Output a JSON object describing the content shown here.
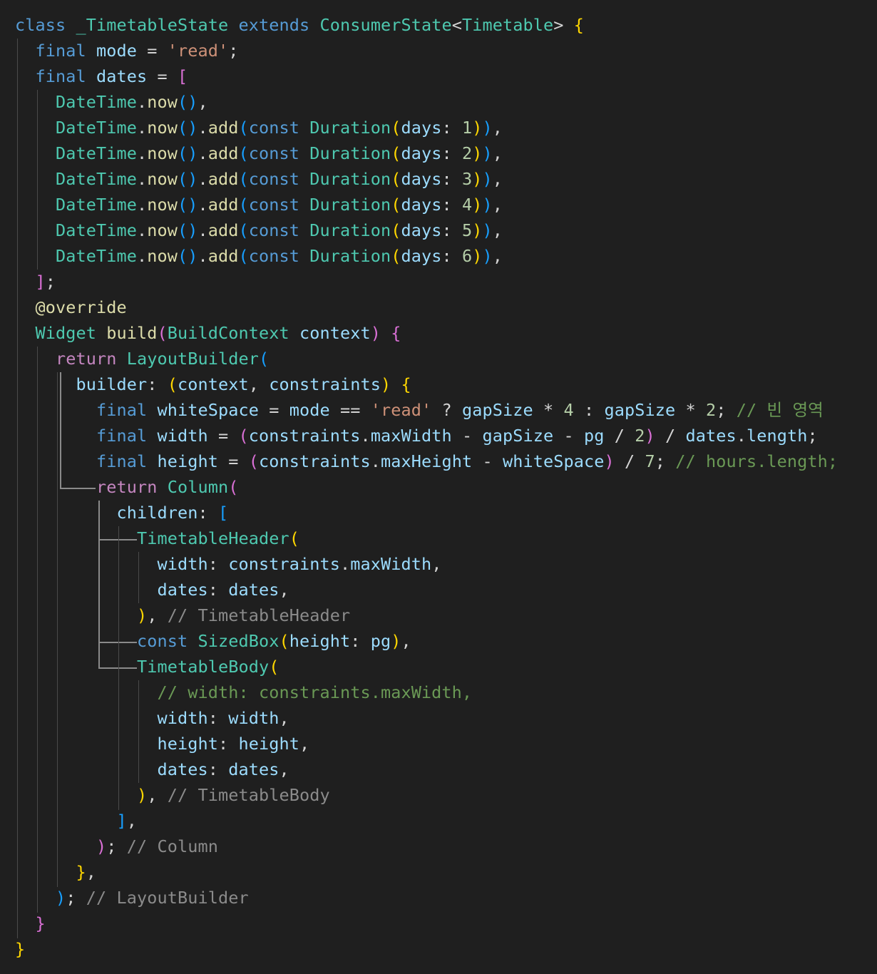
{
  "editor": {
    "background": "#1f1f1f",
    "colors": {
      "kw": "#569cd6",
      "ctrl": "#c586c0",
      "type": "#4ec9b0",
      "fn": "#dcdcaa",
      "var": "#9cdcfe",
      "str": "#ce9178",
      "num": "#b5cea8",
      "cmt": "#6a9955",
      "hint": "#8b8b8b",
      "punct": "#d4d4d4",
      "br1": "#ffd700",
      "br2": "#da70d6",
      "br3": "#179fff"
    },
    "lines": [
      [
        [
          "kw",
          "class"
        ],
        [
          "punct",
          " "
        ],
        [
          "type",
          "_TimetableState"
        ],
        [
          "punct",
          " "
        ],
        [
          "kw",
          "extends"
        ],
        [
          "punct",
          " "
        ],
        [
          "type",
          "ConsumerState"
        ],
        [
          "punct",
          "<"
        ],
        [
          "type",
          "Timetable"
        ],
        [
          "punct",
          "> "
        ],
        [
          "br1",
          "{"
        ]
      ],
      [
        [
          "punct",
          "  "
        ],
        [
          "kw",
          "final"
        ],
        [
          "punct",
          " "
        ],
        [
          "var",
          "mode"
        ],
        [
          "punct",
          " = "
        ],
        [
          "str",
          "'read'"
        ],
        [
          "punct",
          ";"
        ]
      ],
      [
        [
          "punct",
          "  "
        ],
        [
          "kw",
          "final"
        ],
        [
          "punct",
          " "
        ],
        [
          "var",
          "dates"
        ],
        [
          "punct",
          " = "
        ],
        [
          "br2",
          "["
        ]
      ],
      [
        [
          "punct",
          "    "
        ],
        [
          "type",
          "DateTime"
        ],
        [
          "punct",
          "."
        ],
        [
          "fn",
          "now"
        ],
        [
          "br3",
          "()"
        ],
        [
          "punct",
          ","
        ]
      ],
      [
        [
          "punct",
          "    "
        ],
        [
          "type",
          "DateTime"
        ],
        [
          "punct",
          "."
        ],
        [
          "fn",
          "now"
        ],
        [
          "br3",
          "()"
        ],
        [
          "punct",
          "."
        ],
        [
          "fn",
          "add"
        ],
        [
          "br3",
          "("
        ],
        [
          "kw",
          "const"
        ],
        [
          "punct",
          " "
        ],
        [
          "type",
          "Duration"
        ],
        [
          "br1",
          "("
        ],
        [
          "var",
          "days"
        ],
        [
          "punct",
          ": "
        ],
        [
          "num",
          "1"
        ],
        [
          "br1",
          ")"
        ],
        [
          "br3",
          ")"
        ],
        [
          "punct",
          ","
        ]
      ],
      [
        [
          "punct",
          "    "
        ],
        [
          "type",
          "DateTime"
        ],
        [
          "punct",
          "."
        ],
        [
          "fn",
          "now"
        ],
        [
          "br3",
          "()"
        ],
        [
          "punct",
          "."
        ],
        [
          "fn",
          "add"
        ],
        [
          "br3",
          "("
        ],
        [
          "kw",
          "const"
        ],
        [
          "punct",
          " "
        ],
        [
          "type",
          "Duration"
        ],
        [
          "br1",
          "("
        ],
        [
          "var",
          "days"
        ],
        [
          "punct",
          ": "
        ],
        [
          "num",
          "2"
        ],
        [
          "br1",
          ")"
        ],
        [
          "br3",
          ")"
        ],
        [
          "punct",
          ","
        ]
      ],
      [
        [
          "punct",
          "    "
        ],
        [
          "type",
          "DateTime"
        ],
        [
          "punct",
          "."
        ],
        [
          "fn",
          "now"
        ],
        [
          "br3",
          "()"
        ],
        [
          "punct",
          "."
        ],
        [
          "fn",
          "add"
        ],
        [
          "br3",
          "("
        ],
        [
          "kw",
          "const"
        ],
        [
          "punct",
          " "
        ],
        [
          "type",
          "Duration"
        ],
        [
          "br1",
          "("
        ],
        [
          "var",
          "days"
        ],
        [
          "punct",
          ": "
        ],
        [
          "num",
          "3"
        ],
        [
          "br1",
          ")"
        ],
        [
          "br3",
          ")"
        ],
        [
          "punct",
          ","
        ]
      ],
      [
        [
          "punct",
          "    "
        ],
        [
          "type",
          "DateTime"
        ],
        [
          "punct",
          "."
        ],
        [
          "fn",
          "now"
        ],
        [
          "br3",
          "()"
        ],
        [
          "punct",
          "."
        ],
        [
          "fn",
          "add"
        ],
        [
          "br3",
          "("
        ],
        [
          "kw",
          "const"
        ],
        [
          "punct",
          " "
        ],
        [
          "type",
          "Duration"
        ],
        [
          "br1",
          "("
        ],
        [
          "var",
          "days"
        ],
        [
          "punct",
          ": "
        ],
        [
          "num",
          "4"
        ],
        [
          "br1",
          ")"
        ],
        [
          "br3",
          ")"
        ],
        [
          "punct",
          ","
        ]
      ],
      [
        [
          "punct",
          "    "
        ],
        [
          "type",
          "DateTime"
        ],
        [
          "punct",
          "."
        ],
        [
          "fn",
          "now"
        ],
        [
          "br3",
          "()"
        ],
        [
          "punct",
          "."
        ],
        [
          "fn",
          "add"
        ],
        [
          "br3",
          "("
        ],
        [
          "kw",
          "const"
        ],
        [
          "punct",
          " "
        ],
        [
          "type",
          "Duration"
        ],
        [
          "br1",
          "("
        ],
        [
          "var",
          "days"
        ],
        [
          "punct",
          ": "
        ],
        [
          "num",
          "5"
        ],
        [
          "br1",
          ")"
        ],
        [
          "br3",
          ")"
        ],
        [
          "punct",
          ","
        ]
      ],
      [
        [
          "punct",
          "    "
        ],
        [
          "type",
          "DateTime"
        ],
        [
          "punct",
          "."
        ],
        [
          "fn",
          "now"
        ],
        [
          "br3",
          "()"
        ],
        [
          "punct",
          "."
        ],
        [
          "fn",
          "add"
        ],
        [
          "br3",
          "("
        ],
        [
          "kw",
          "const"
        ],
        [
          "punct",
          " "
        ],
        [
          "type",
          "Duration"
        ],
        [
          "br1",
          "("
        ],
        [
          "var",
          "days"
        ],
        [
          "punct",
          ": "
        ],
        [
          "num",
          "6"
        ],
        [
          "br1",
          ")"
        ],
        [
          "br3",
          ")"
        ],
        [
          "punct",
          ","
        ]
      ],
      [
        [
          "punct",
          "  "
        ],
        [
          "br2",
          "]"
        ],
        [
          "punct",
          ";"
        ]
      ],
      [
        [
          "punct",
          "  "
        ],
        [
          "fn",
          "@override"
        ]
      ],
      [
        [
          "punct",
          "  "
        ],
        [
          "type",
          "Widget"
        ],
        [
          "punct",
          " "
        ],
        [
          "fn",
          "build"
        ],
        [
          "br2",
          "("
        ],
        [
          "type",
          "BuildContext"
        ],
        [
          "punct",
          " "
        ],
        [
          "var",
          "context"
        ],
        [
          "br2",
          ")"
        ],
        [
          "punct",
          " "
        ],
        [
          "br2",
          "{"
        ]
      ],
      [
        [
          "punct",
          "    "
        ],
        [
          "ctrl",
          "return"
        ],
        [
          "punct",
          " "
        ],
        [
          "type",
          "LayoutBuilder"
        ],
        [
          "br3",
          "("
        ]
      ],
      [
        [
          "punct",
          "      "
        ],
        [
          "var",
          "builder"
        ],
        [
          "punct",
          ": "
        ],
        [
          "br1",
          "("
        ],
        [
          "var",
          "context"
        ],
        [
          "punct",
          ", "
        ],
        [
          "var",
          "constraints"
        ],
        [
          "br1",
          ")"
        ],
        [
          "punct",
          " "
        ],
        [
          "br1",
          "{"
        ]
      ],
      [
        [
          "punct",
          "        "
        ],
        [
          "kw",
          "final"
        ],
        [
          "punct",
          " "
        ],
        [
          "var",
          "whiteSpace"
        ],
        [
          "punct",
          " = "
        ],
        [
          "var",
          "mode"
        ],
        [
          "punct",
          " == "
        ],
        [
          "str",
          "'read'"
        ],
        [
          "punct",
          " ? "
        ],
        [
          "var",
          "gapSize"
        ],
        [
          "punct",
          " * "
        ],
        [
          "num",
          "4"
        ],
        [
          "punct",
          " : "
        ],
        [
          "var",
          "gapSize"
        ],
        [
          "punct",
          " * "
        ],
        [
          "num",
          "2"
        ],
        [
          "punct",
          "; "
        ],
        [
          "cmt",
          "// 빈 영역"
        ]
      ],
      [
        [
          "punct",
          "        "
        ],
        [
          "kw",
          "final"
        ],
        [
          "punct",
          " "
        ],
        [
          "var",
          "width"
        ],
        [
          "punct",
          " = "
        ],
        [
          "br2",
          "("
        ],
        [
          "var",
          "constraints"
        ],
        [
          "punct",
          "."
        ],
        [
          "var",
          "maxWidth"
        ],
        [
          "punct",
          " - "
        ],
        [
          "var",
          "gapSize"
        ],
        [
          "punct",
          " - "
        ],
        [
          "var",
          "pg"
        ],
        [
          "punct",
          " / "
        ],
        [
          "num",
          "2"
        ],
        [
          "br2",
          ")"
        ],
        [
          "punct",
          " / "
        ],
        [
          "var",
          "dates"
        ],
        [
          "punct",
          "."
        ],
        [
          "var",
          "length"
        ],
        [
          "punct",
          ";"
        ]
      ],
      [
        [
          "punct",
          "        "
        ],
        [
          "kw",
          "final"
        ],
        [
          "punct",
          " "
        ],
        [
          "var",
          "height"
        ],
        [
          "punct",
          " = "
        ],
        [
          "br2",
          "("
        ],
        [
          "var",
          "constraints"
        ],
        [
          "punct",
          "."
        ],
        [
          "var",
          "maxHeight"
        ],
        [
          "punct",
          " - "
        ],
        [
          "var",
          "whiteSpace"
        ],
        [
          "br2",
          ")"
        ],
        [
          "punct",
          " / "
        ],
        [
          "num",
          "7"
        ],
        [
          "punct",
          "; "
        ],
        [
          "cmt",
          "// hours.length;"
        ]
      ],
      [
        [
          "punct",
          "        "
        ],
        [
          "ctrl",
          "return"
        ],
        [
          "punct",
          " "
        ],
        [
          "type",
          "Column"
        ],
        [
          "br2",
          "("
        ]
      ],
      [
        [
          "punct",
          "          "
        ],
        [
          "var",
          "children"
        ],
        [
          "punct",
          ": "
        ],
        [
          "br3",
          "["
        ]
      ],
      [
        [
          "punct",
          "            "
        ],
        [
          "type",
          "TimetableHeader"
        ],
        [
          "br1",
          "("
        ]
      ],
      [
        [
          "punct",
          "              "
        ],
        [
          "var",
          "width"
        ],
        [
          "punct",
          ": "
        ],
        [
          "var",
          "constraints"
        ],
        [
          "punct",
          "."
        ],
        [
          "var",
          "maxWidth"
        ],
        [
          "punct",
          ","
        ]
      ],
      [
        [
          "punct",
          "              "
        ],
        [
          "var",
          "dates"
        ],
        [
          "punct",
          ": "
        ],
        [
          "var",
          "dates"
        ],
        [
          "punct",
          ","
        ]
      ],
      [
        [
          "punct",
          "            "
        ],
        [
          "br1",
          ")"
        ],
        [
          "punct",
          ", "
        ],
        [
          "hint",
          "// TimetableHeader"
        ]
      ],
      [
        [
          "punct",
          "            "
        ],
        [
          "kw",
          "const"
        ],
        [
          "punct",
          " "
        ],
        [
          "type",
          "SizedBox"
        ],
        [
          "br1",
          "("
        ],
        [
          "var",
          "height"
        ],
        [
          "punct",
          ": "
        ],
        [
          "var",
          "pg"
        ],
        [
          "br1",
          ")"
        ],
        [
          "punct",
          ","
        ]
      ],
      [
        [
          "punct",
          "            "
        ],
        [
          "type",
          "TimetableBody"
        ],
        [
          "br1",
          "("
        ]
      ],
      [
        [
          "punct",
          "              "
        ],
        [
          "cmt",
          "// width: constraints.maxWidth,"
        ]
      ],
      [
        [
          "punct",
          "              "
        ],
        [
          "var",
          "width"
        ],
        [
          "punct",
          ": "
        ],
        [
          "var",
          "width"
        ],
        [
          "punct",
          ","
        ]
      ],
      [
        [
          "punct",
          "              "
        ],
        [
          "var",
          "height"
        ],
        [
          "punct",
          ": "
        ],
        [
          "var",
          "height"
        ],
        [
          "punct",
          ","
        ]
      ],
      [
        [
          "punct",
          "              "
        ],
        [
          "var",
          "dates"
        ],
        [
          "punct",
          ": "
        ],
        [
          "var",
          "dates"
        ],
        [
          "punct",
          ","
        ]
      ],
      [
        [
          "punct",
          "            "
        ],
        [
          "br1",
          ")"
        ],
        [
          "punct",
          ", "
        ],
        [
          "hint",
          "// TimetableBody"
        ]
      ],
      [
        [
          "punct",
          "          "
        ],
        [
          "br3",
          "]"
        ],
        [
          "punct",
          ","
        ]
      ],
      [
        [
          "punct",
          "        "
        ],
        [
          "br2",
          ")"
        ],
        [
          "punct",
          "; "
        ],
        [
          "hint",
          "// Column"
        ]
      ],
      [
        [
          "punct",
          "      "
        ],
        [
          "br1",
          "}"
        ],
        [
          "punct",
          ","
        ]
      ],
      [
        [
          "punct",
          "    "
        ],
        [
          "br3",
          ")"
        ],
        [
          "punct",
          "; "
        ],
        [
          "hint",
          "// LayoutBuilder"
        ]
      ],
      [
        [
          "punct",
          "  "
        ],
        [
          "br2",
          "}"
        ]
      ],
      [
        [
          "br1",
          "}"
        ]
      ]
    ]
  }
}
